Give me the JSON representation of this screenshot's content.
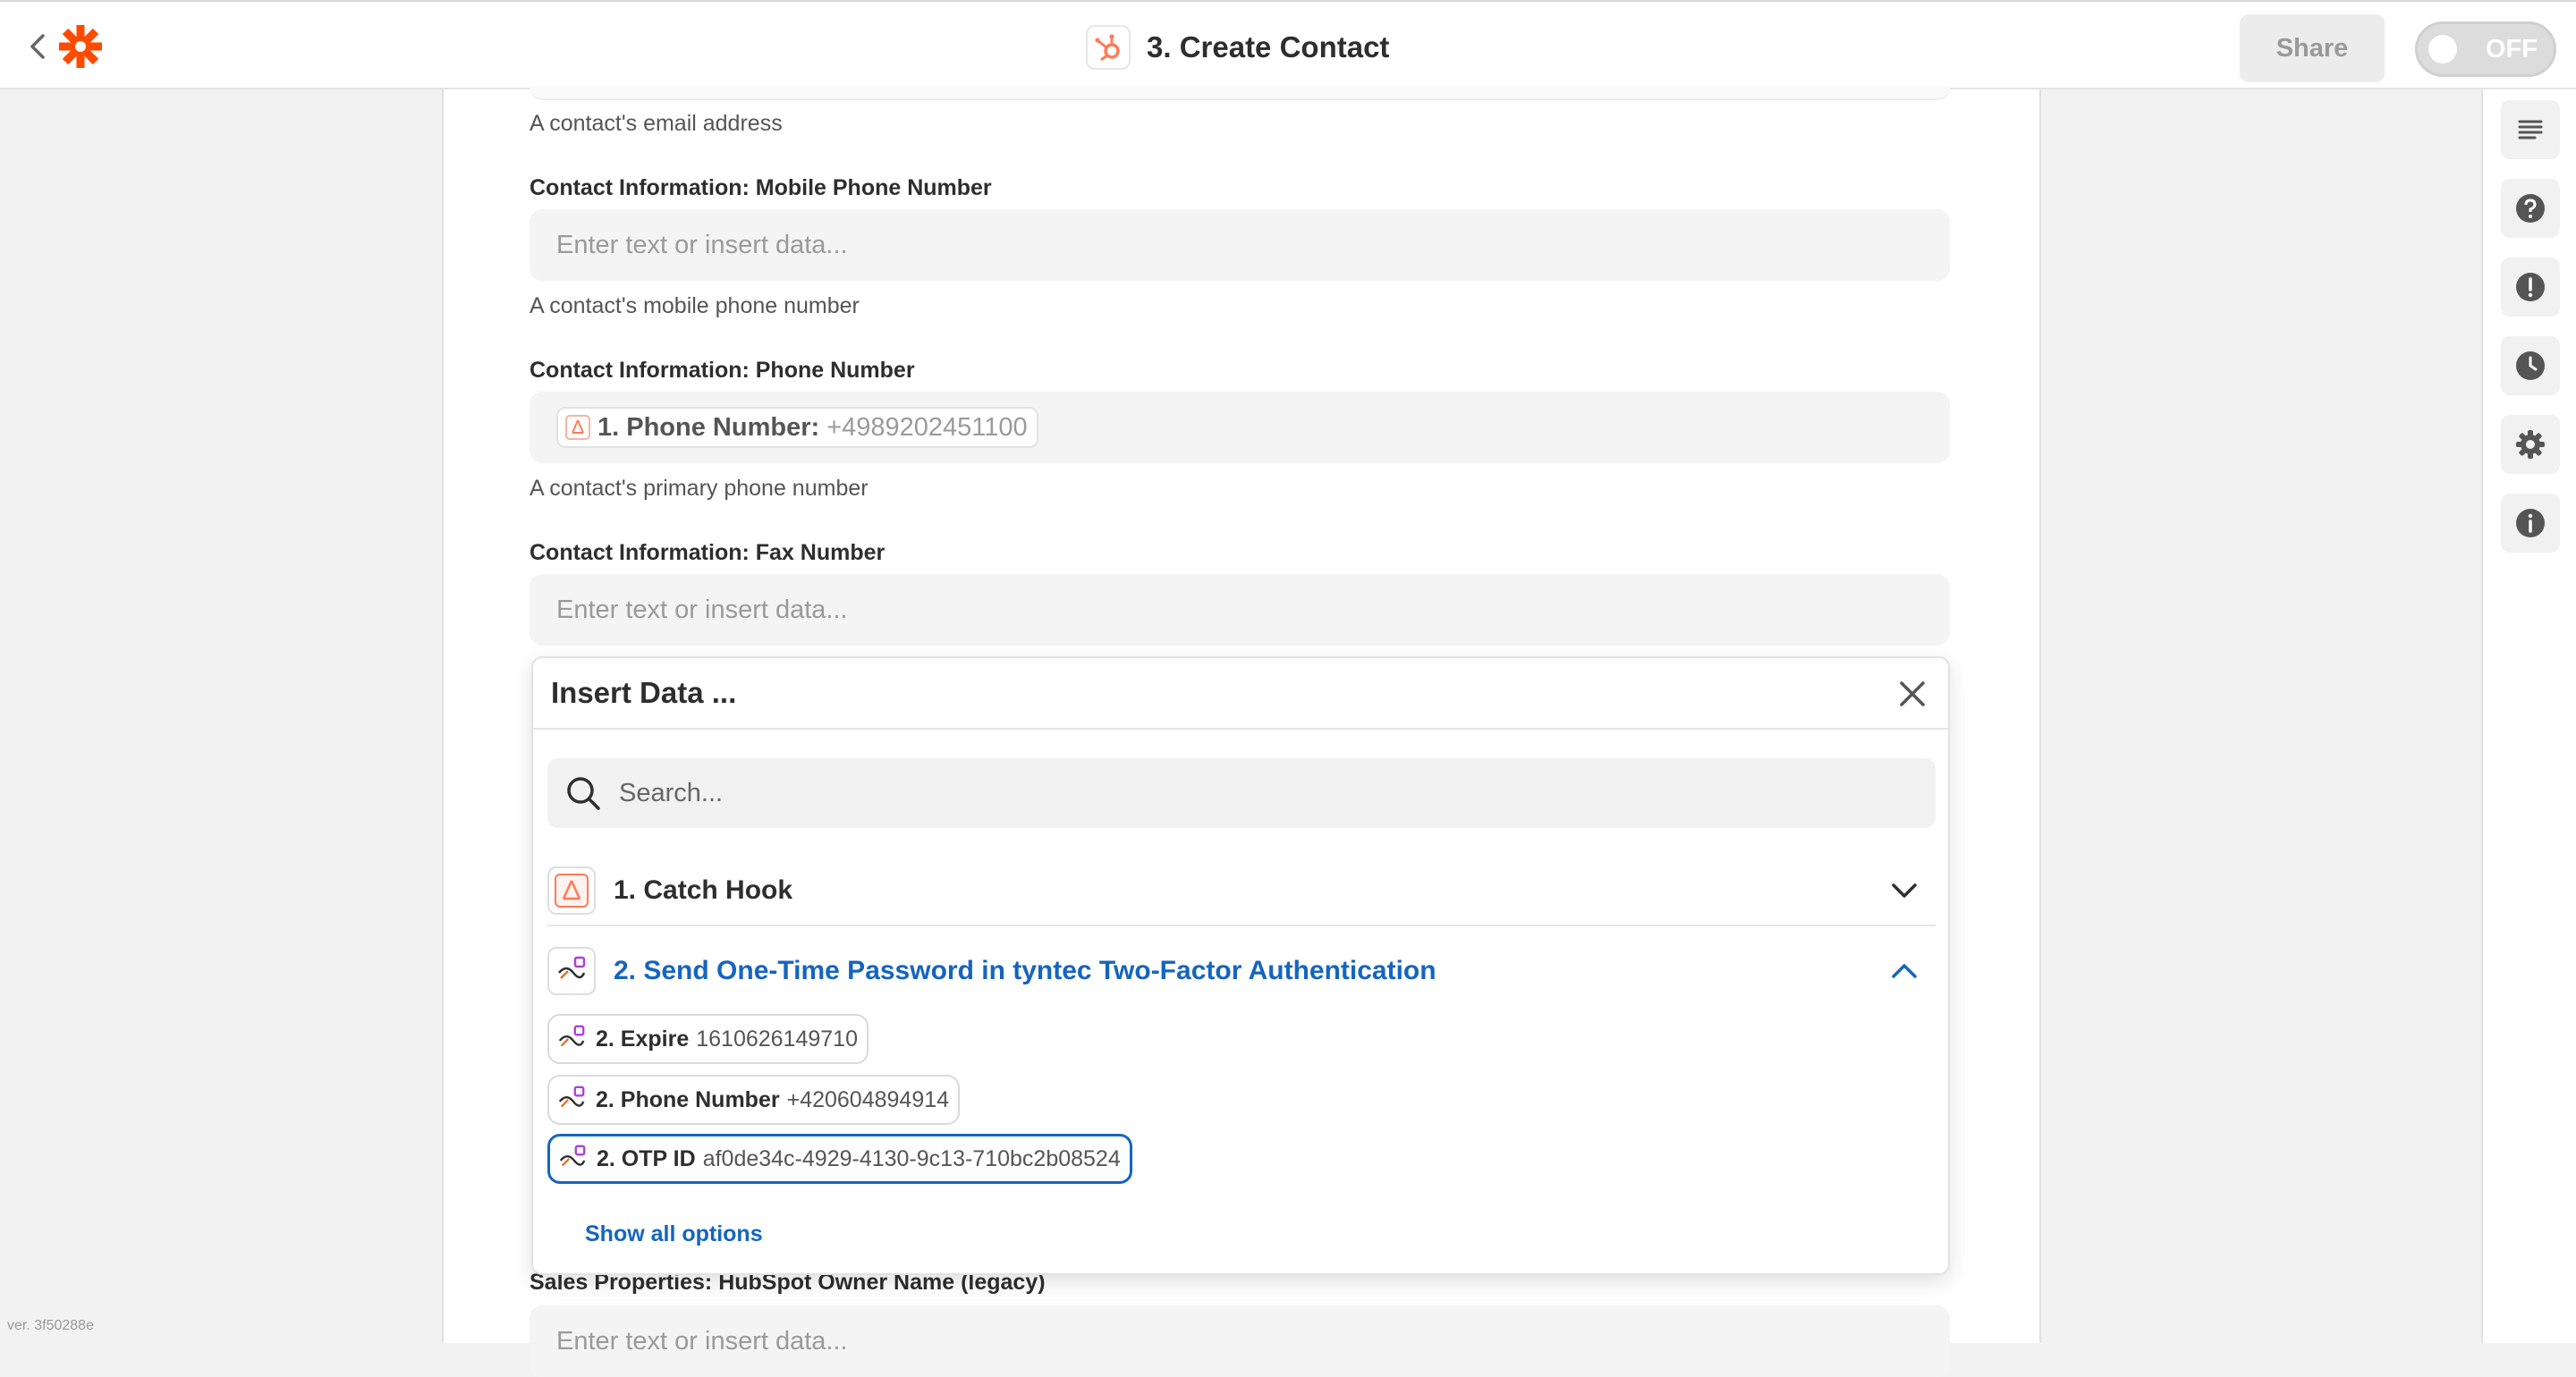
{
  "header": {
    "title": "3. Create Contact",
    "share_label": "Share",
    "toggle_label": "OFF"
  },
  "form": {
    "email_help": "A contact's email address",
    "mobile": {
      "label": "Contact Information: Mobile Phone Number",
      "placeholder": "Enter text or insert data...",
      "help": "A contact's mobile phone number"
    },
    "phone": {
      "label": "Contact Information: Phone Number",
      "pill_key": "1. Phone Number:",
      "pill_value": "+4989202451100",
      "help": "A contact's primary phone number"
    },
    "fax": {
      "label": "Contact Information: Fax Number",
      "placeholder": "Enter text or insert data..."
    },
    "owner": {
      "label": "Sales Properties: HubSpot Owner Name (legacy)",
      "placeholder": "Enter text or insert data..."
    }
  },
  "insert_data": {
    "title": "Insert Data ...",
    "search_placeholder": "Search...",
    "steps": [
      {
        "label": "1. Catch Hook",
        "expanded": false
      },
      {
        "label": "2. Send One-Time Password in tyntec Two-Factor Authentication",
        "expanded": true
      }
    ],
    "items": [
      {
        "key": "2. Expire",
        "value": "1610626149710",
        "selected": false
      },
      {
        "key": "2. Phone Number",
        "value": "+420604894914",
        "selected": false
      },
      {
        "key": "2. OTP ID",
        "value": "af0de34c-4929-4130-9c13-710bc2b08524",
        "selected": true
      }
    ],
    "show_all_label": "Show all options"
  },
  "sidebar": {
    "icons": [
      "outline-icon",
      "help-icon",
      "alert-icon",
      "history-icon",
      "settings-icon",
      "info-icon"
    ]
  },
  "version": "ver. 3f50288e",
  "colors": {
    "brand": "#ff4a00",
    "hubspot": "#ff7a59",
    "link_blue": "#1565c0",
    "tyntec_purple": "#b03fd6"
  }
}
